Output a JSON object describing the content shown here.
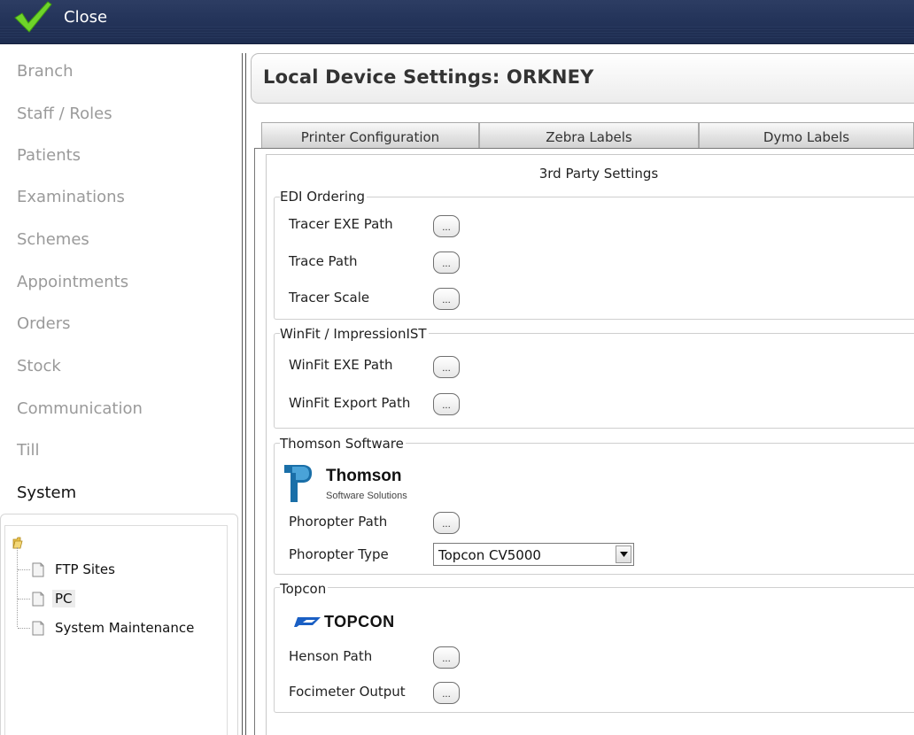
{
  "toolbar": {
    "close_label": "Close",
    "close_icon": "checkmark-icon",
    "accent_color": "#6fd42a"
  },
  "nav": {
    "items": [
      {
        "label": "Branch"
      },
      {
        "label": "Staff / Roles"
      },
      {
        "label": "Patients"
      },
      {
        "label": "Examinations"
      },
      {
        "label": "Schemes"
      },
      {
        "label": "Appointments"
      },
      {
        "label": "Orders"
      },
      {
        "label": "Stock"
      },
      {
        "label": "Communication"
      },
      {
        "label": "Till"
      },
      {
        "label": "System",
        "active": true
      }
    ]
  },
  "tree": {
    "root_icon": "folder-icon",
    "items": [
      {
        "label": "FTP Sites",
        "icon": "document-icon"
      },
      {
        "label": "PC",
        "icon": "document-icon",
        "selected": true
      },
      {
        "label": "System Maintenance",
        "icon": "document-icon"
      }
    ]
  },
  "page": {
    "title": "Local Device Settings: ORKNEY"
  },
  "tabs": [
    {
      "label": "Printer Configuration"
    },
    {
      "label": "Zebra Labels"
    },
    {
      "label": "Dymo Labels"
    }
  ],
  "panel": {
    "heading": "3rd Party Settings",
    "browse_label": "...",
    "groups": {
      "edi": {
        "legend": "EDI Ordering",
        "fields": {
          "tracer_exe": "Tracer EXE Path",
          "trace_path": "Trace Path",
          "tracer_scale": "Tracer Scale"
        }
      },
      "winfit": {
        "legend": "WinFit / ImpressionIST",
        "fields": {
          "exe_path": "WinFit EXE Path",
          "export_path": "WinFit Export Path"
        }
      },
      "thomson": {
        "legend": "Thomson Software",
        "logo_name": "Thomson",
        "logo_sub": "Software Solutions",
        "fields": {
          "phoropter_path": "Phoropter Path",
          "phoropter_type": "Phoropter Type"
        },
        "phoropter_type_value": "Topcon CV5000",
        "brand_color": "#1a6fa8"
      },
      "topcon": {
        "legend": "Topcon",
        "logo_word": "TOPCON",
        "brand_color": "#1a5fc4",
        "fields": {
          "henson_path": "Henson Path",
          "focimeter_output": "Focimeter Output"
        }
      }
    }
  }
}
